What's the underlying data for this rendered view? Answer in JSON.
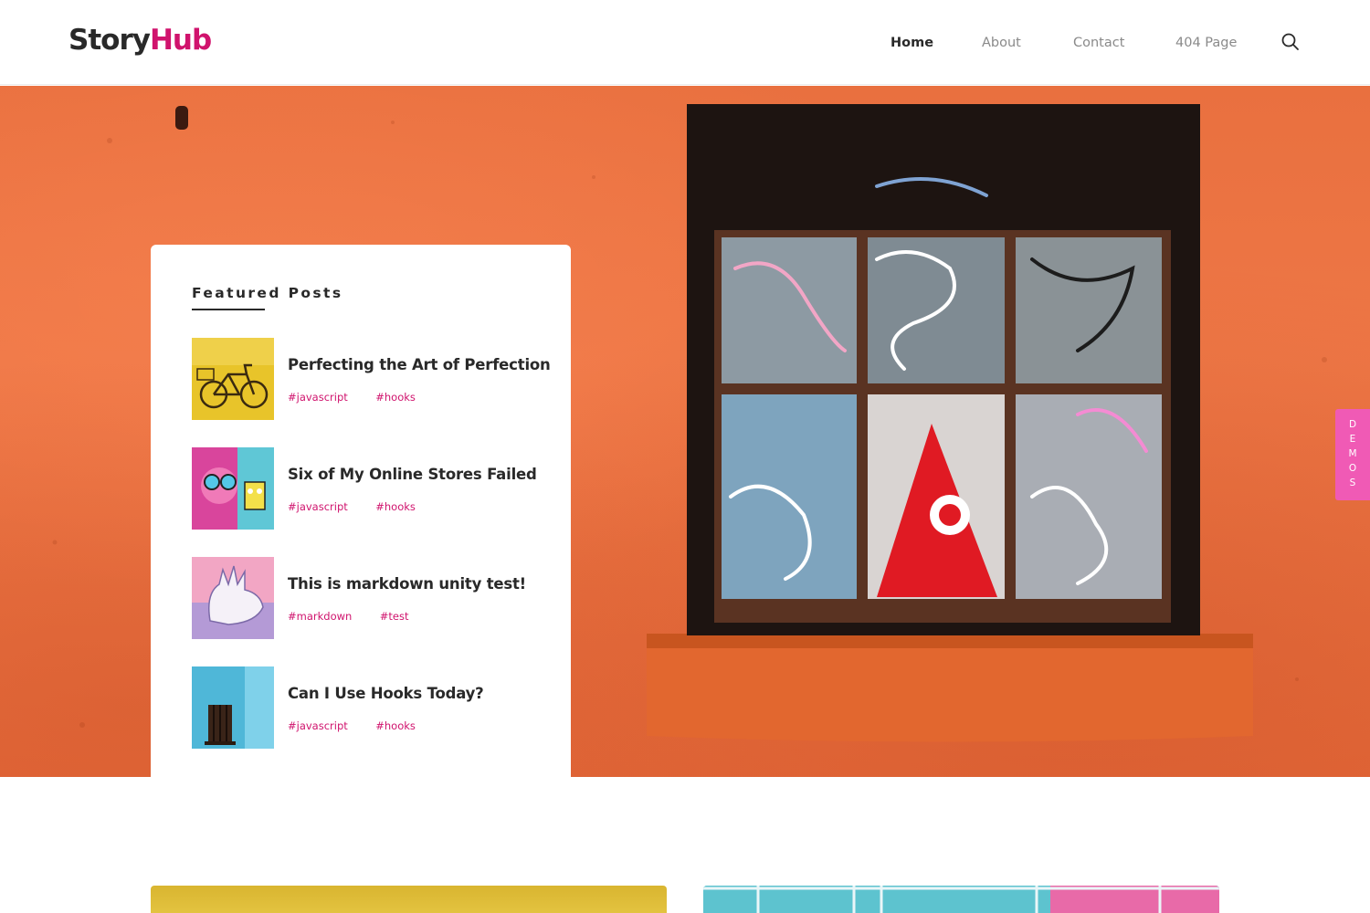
{
  "header": {
    "logo_part1": "Story",
    "logo_part2": "Hub",
    "nav": [
      {
        "label": "Home",
        "active": true
      },
      {
        "label": "About",
        "active": false
      },
      {
        "label": "Contact",
        "active": false
      },
      {
        "label": "404 Page",
        "active": false
      }
    ],
    "search_icon": "search-icon"
  },
  "featured": {
    "title": "Featured Posts",
    "posts": [
      {
        "title": "Perfecting the Art of Perfection",
        "tags": [
          "#javascript",
          "#hooks"
        ],
        "thumb": "yellow-bicycle"
      },
      {
        "title": "Six of My Online Stores Failed",
        "tags": [
          "#javascript",
          "#hooks"
        ],
        "thumb": "graffiti-mural"
      },
      {
        "title": "This is markdown unity test!",
        "tags": [
          "#markdown",
          "#test"
        ],
        "thumb": "white-glove-art"
      },
      {
        "title": "Can I Use Hooks Today?",
        "tags": [
          "#javascript",
          "#hooks"
        ],
        "thumb": "blue-wall-window"
      }
    ]
  },
  "demos_tab": "DEMOS",
  "colors": {
    "accent": "#d0136d",
    "text": "#292929",
    "nav_muted": "#8a8a8a",
    "demos_bg": "#f05ab5",
    "hero_bg": "#ec7443"
  }
}
